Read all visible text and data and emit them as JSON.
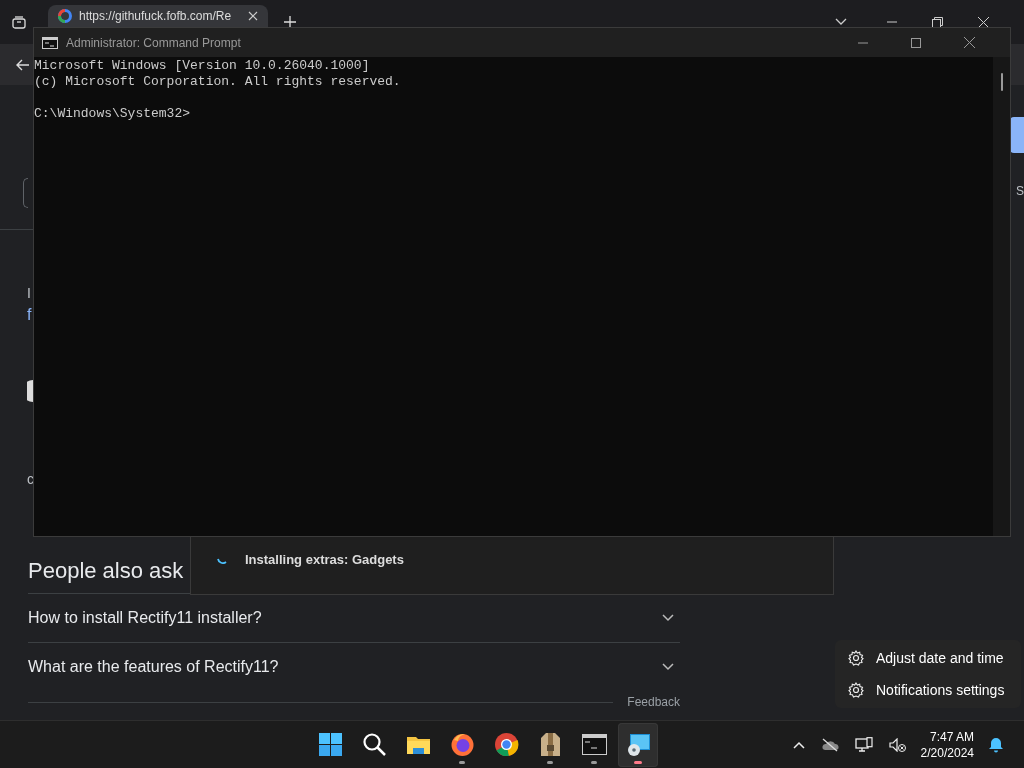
{
  "browser": {
    "tab": {
      "title": "https://githufuck.fofb.com/Re"
    },
    "page": {
      "left_fragments": [
        {
          "text": "I",
          "kind": "text"
        },
        {
          "text": "f",
          "kind": "link"
        },
        {
          "text": "c",
          "kind": "snippet"
        }
      ],
      "right_fragments": [
        {
          "text": "S",
          "kind": "text"
        }
      ],
      "people_also_ask": {
        "title": "People also ask",
        "questions": [
          {
            "text": "How to install Rectify11 installer?",
            "expanded": false
          },
          {
            "text": "What are the features of Rectify11?",
            "expanded": false
          }
        ]
      },
      "feedback": "Feedback"
    }
  },
  "cmd": {
    "title": "Administrator: Command Prompt",
    "banner": [
      "Microsoft Windows [Version 10.0.26040.1000]",
      "(c) Microsoft Corporation. All rights reserved."
    ],
    "prompt": "C:\\Windows\\System32>"
  },
  "installer": {
    "status": "Installing extras: Gadgets"
  },
  "context_menu": {
    "items": [
      {
        "label": "Adjust date and time"
      },
      {
        "label": "Notifications settings"
      }
    ]
  },
  "taskbar": {
    "apps": [
      {
        "kind": "start",
        "running": false,
        "active": false
      },
      {
        "kind": "search",
        "running": false,
        "active": false
      },
      {
        "kind": "files",
        "running": false,
        "active": false
      },
      {
        "kind": "firefox",
        "running": true,
        "active": false
      },
      {
        "kind": "chrome",
        "running": false,
        "active": false
      },
      {
        "kind": "package",
        "running": true,
        "active": false
      },
      {
        "kind": "terminal",
        "running": true,
        "active": false
      },
      {
        "kind": "setup",
        "running": true,
        "active": true
      }
    ],
    "clock": {
      "time": "7:47 AM",
      "date": "2/20/2024"
    }
  }
}
